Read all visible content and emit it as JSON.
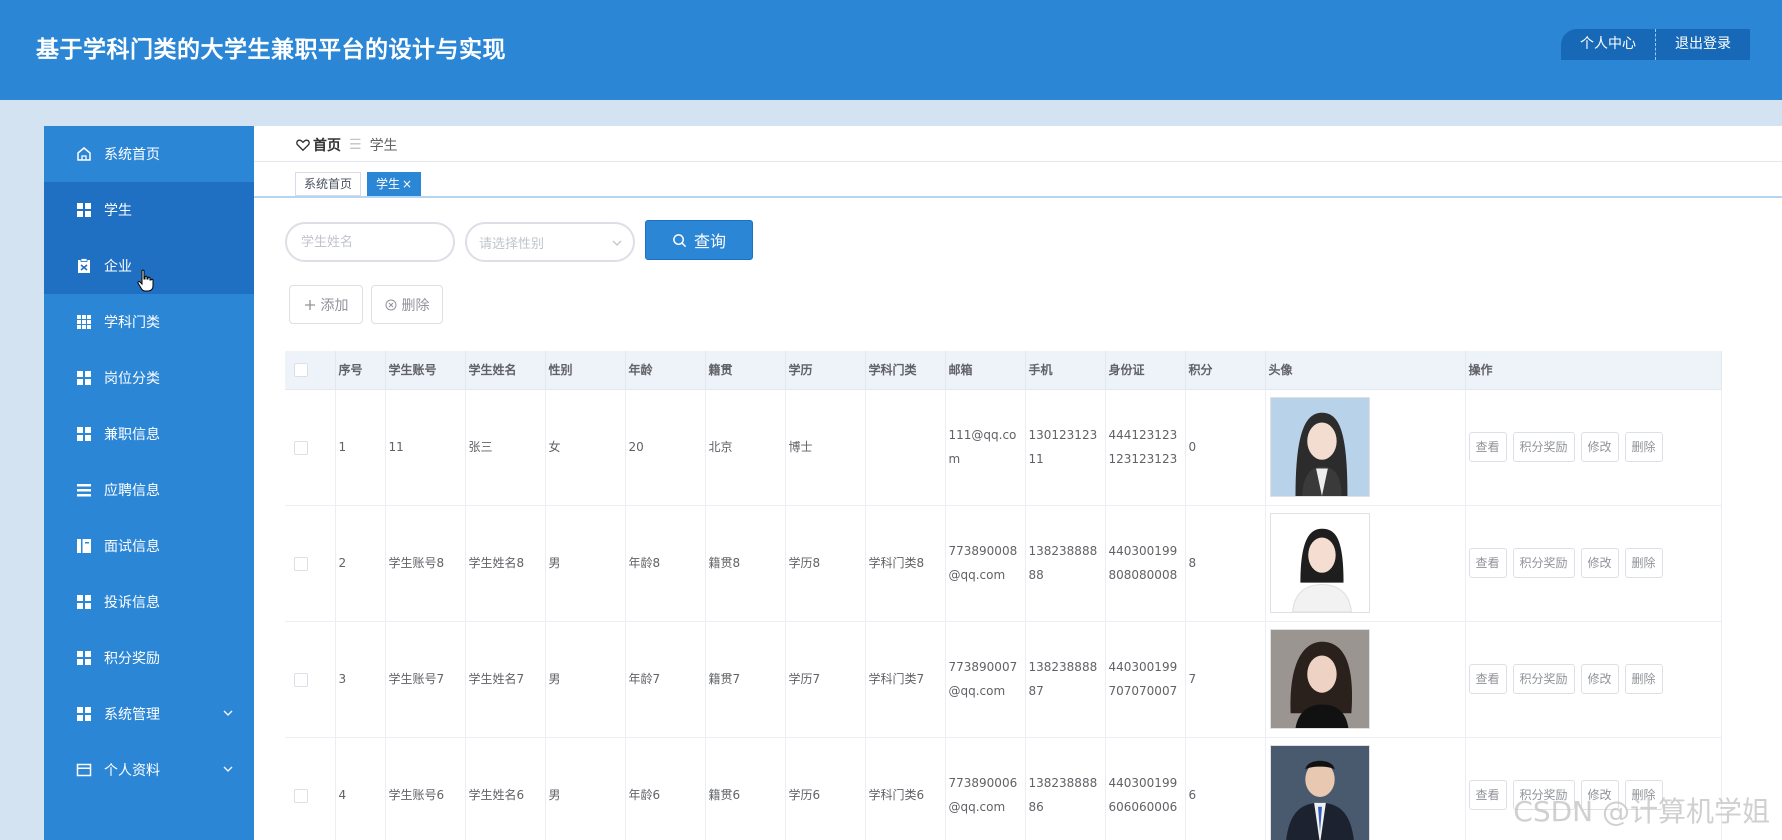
{
  "header": {
    "title": "基于学科门类的大学生兼职平台的设计与实现",
    "personal_center": "个人中心",
    "logout": "退出登录"
  },
  "sidebar": {
    "items": [
      {
        "label": "系统首页",
        "icon": "home-icon"
      },
      {
        "label": "学生",
        "icon": "grid-icon"
      },
      {
        "label": "企业",
        "icon": "clipboard-icon"
      },
      {
        "label": "学科门类",
        "icon": "table-icon"
      },
      {
        "label": "岗位分类",
        "icon": "grid-icon"
      },
      {
        "label": "兼职信息",
        "icon": "grid-icon"
      },
      {
        "label": "应聘信息",
        "icon": "list-icon"
      },
      {
        "label": "面试信息",
        "icon": "book-icon"
      },
      {
        "label": "投诉信息",
        "icon": "grid-icon"
      },
      {
        "label": "积分奖励",
        "icon": "grid-icon"
      },
      {
        "label": "系统管理",
        "icon": "grid-icon"
      },
      {
        "label": "个人资料",
        "icon": "card-icon"
      }
    ]
  },
  "breadcrumb": {
    "home": "首页",
    "separator": "☰",
    "current": "学生"
  },
  "tabs": [
    {
      "label": "系统首页"
    },
    {
      "label": "学生",
      "close": "×"
    }
  ],
  "search": {
    "name_placeholder": "学生姓名",
    "gender_placeholder": "请选择性别",
    "query_label": "查询"
  },
  "actions": {
    "add": "添加",
    "delete": "删除"
  },
  "table": {
    "headers": [
      "序号",
      "学生账号",
      "学生姓名",
      "性别",
      "年龄",
      "籍贯",
      "学历",
      "学科门类",
      "邮箱",
      "手机",
      "身份证",
      "积分",
      "头像",
      "操作"
    ],
    "rows": [
      {
        "seq": "1",
        "account": "11",
        "name": "张三",
        "gender": "女",
        "age": "20",
        "origin": "北京",
        "education": "博士",
        "category": "",
        "email": "111@qq.com",
        "phone": "13012312311",
        "idcard": "444123123123123123",
        "points": "0"
      },
      {
        "seq": "2",
        "account": "学生账号8",
        "name": "学生姓名8",
        "gender": "男",
        "age": "年龄8",
        "origin": "籍贯8",
        "education": "学历8",
        "category": "学科门类8",
        "email": "773890008@qq.com",
        "phone": "13823888888",
        "idcard": "440300199808080008",
        "points": "8"
      },
      {
        "seq": "3",
        "account": "学生账号7",
        "name": "学生姓名7",
        "gender": "男",
        "age": "年龄7",
        "origin": "籍贯7",
        "education": "学历7",
        "category": "学科门类7",
        "email": "773890007@qq.com",
        "phone": "13823888887",
        "idcard": "440300199707070007",
        "points": "7"
      },
      {
        "seq": "4",
        "account": "学生账号6",
        "name": "学生姓名6",
        "gender": "男",
        "age": "年龄6",
        "origin": "籍贯6",
        "education": "学历6",
        "category": "学科门类6",
        "email": "773890006@qq.com",
        "phone": "13823888886",
        "idcard": "440300199606060006",
        "points": "6"
      }
    ],
    "row_actions": [
      "查看",
      "积分奖励",
      "修改",
      "删除"
    ]
  },
  "watermark": "CSDN @计算机学姐",
  "colors": {
    "primary": "#2b86d6",
    "sidebar_active": "#1f70c2",
    "page_bg": "#d4e3f2"
  }
}
